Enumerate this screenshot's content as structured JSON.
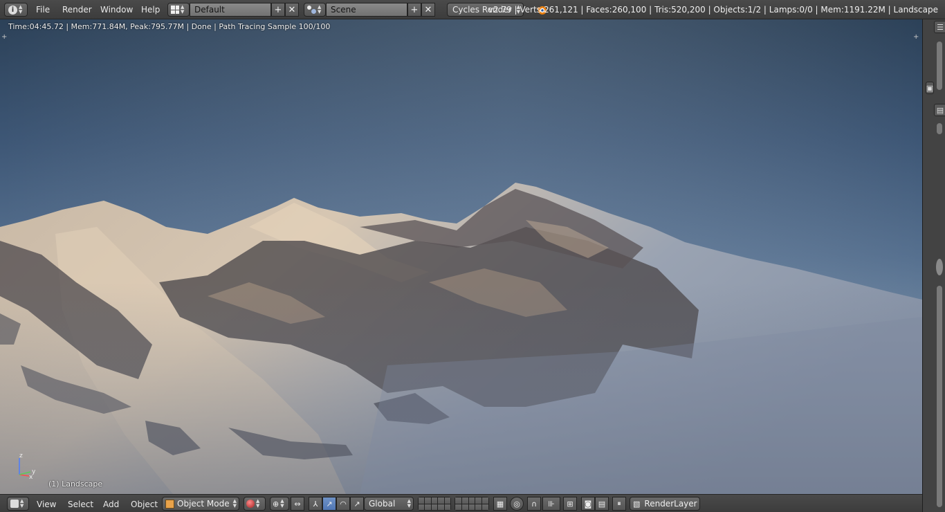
{
  "topbar": {
    "menus": [
      "File",
      "Render",
      "Window",
      "Help"
    ],
    "screen_layout": "Default",
    "scene": "Scene",
    "render_engine": "Cycles Render",
    "stats": "v2.79 | Verts:261,121 | Faces:260,100 | Tris:520,200 | Objects:1/2 | Lamps:0/0 | Mem:1191.22M | Landscape"
  },
  "viewport": {
    "render_info": "Time:04:45.72 | Mem:771.84M, Peak:795.77M | Done | Path Tracing Sample 100/100",
    "object_label": "(1) Landscape",
    "axes": {
      "x": "x",
      "y": "y",
      "z": "z"
    }
  },
  "bottombar": {
    "menus": [
      "View",
      "Select",
      "Add",
      "Object"
    ],
    "mode": "Object Mode",
    "transform_orientation": "Global",
    "render_layer": "RenderLayer"
  },
  "colors": {
    "active_button": "#5a82bf",
    "sky_top": "#2c4158",
    "sky_bottom": "#8ea3b7"
  }
}
